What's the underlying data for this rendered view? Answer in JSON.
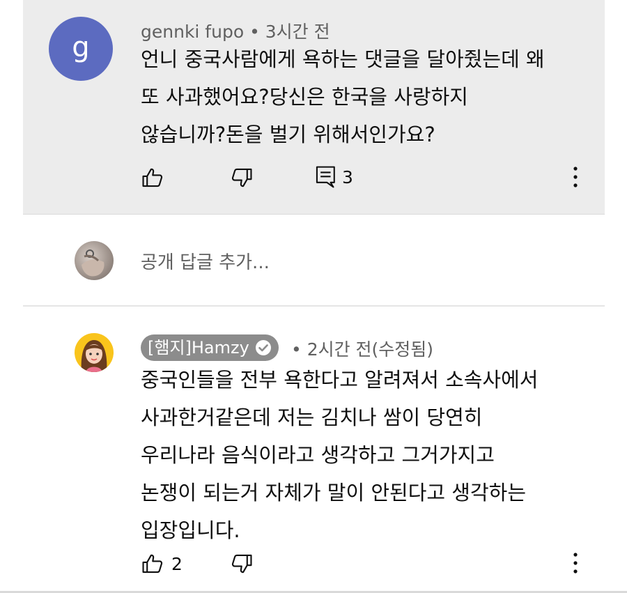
{
  "comment": {
    "avatar_letter": "g",
    "avatar_color": "#5c6bc0",
    "author": "gennki fupo",
    "time": " • 3시간 전",
    "lines": [
      "언니 중국사람에게 욕하는 댓글을 달아줬는데 왜",
      "또 사과했어요?당신은 한국을 사랑하지",
      "않습니까?돈을 벌기 위해서인가요?"
    ],
    "reply_count": "3"
  },
  "reply_input": {
    "placeholder": "공개 답글 추가..."
  },
  "reply": {
    "author": "[햄지]Hamzy",
    "time": " • 2시간 전(수정됨)",
    "lines": [
      "중국인들을 전부 욕한다고 알려져서 소속사에서",
      "사과한거같은데 저는 김치나 쌈이 당연히",
      "우리나라 음식이라고 생각하고 그거가지고",
      "논쟁이 되는거 자체가 말이 안된다고 생각하는",
      "입장입니다."
    ],
    "like_count": "2"
  },
  "colors": {
    "highlight_bg": "#ececec",
    "chip_bg": "#8c8c8c",
    "secondary_text": "#606060"
  },
  "icons": [
    "thumbs-up-icon",
    "thumbs-down-icon",
    "comment-icon",
    "more-vertical-icon",
    "verified-check-icon"
  ]
}
